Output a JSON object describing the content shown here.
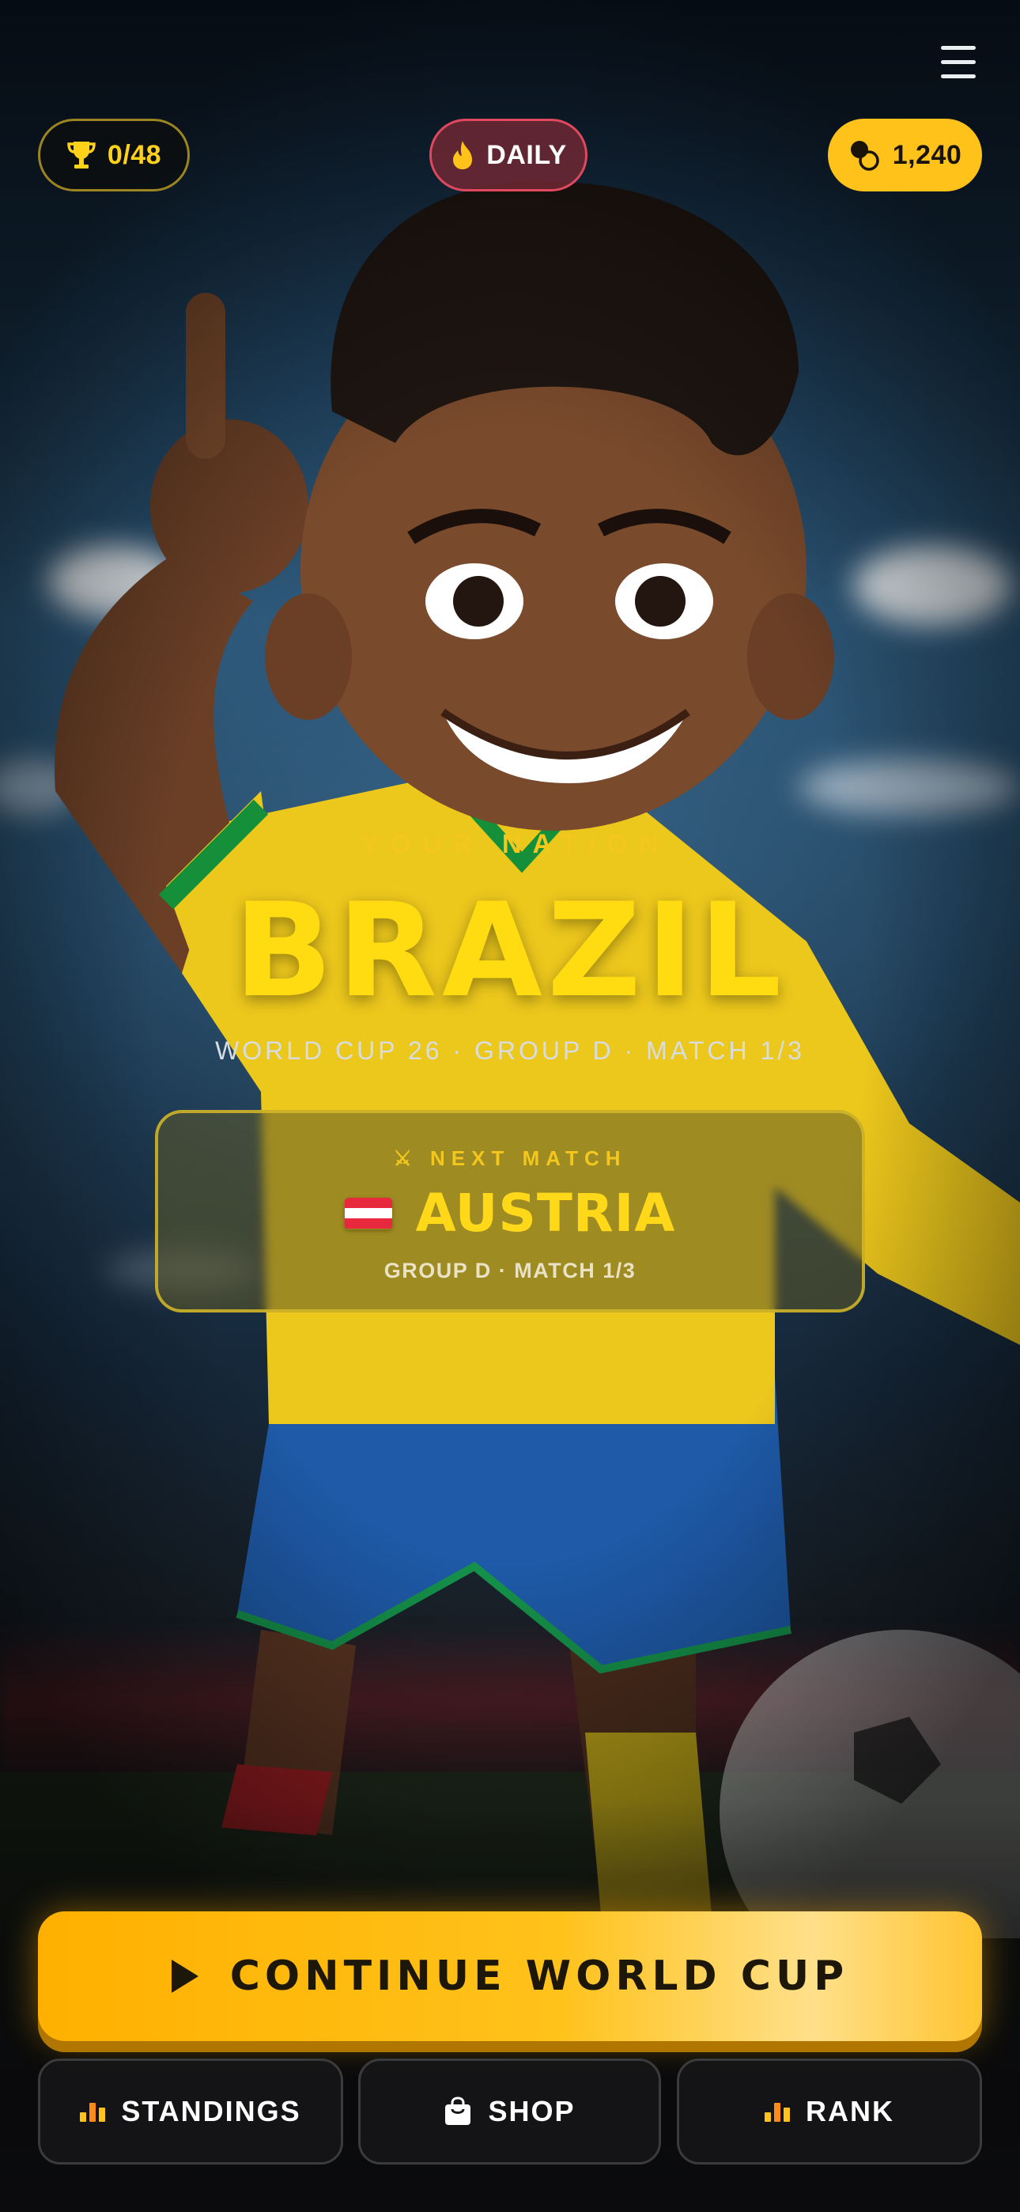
{
  "top_bar": {
    "trophy_count": "0/48",
    "daily_label": "DAILY",
    "coins": "1,240"
  },
  "hero": {
    "nation_label": "YOUR NATION",
    "nation_name": "BRAZIL",
    "subtitle": "WORLD CUP 26 · GROUP D · MATCH 1/3"
  },
  "next_match": {
    "label": "⚔ NEXT MATCH",
    "opponent": "AUSTRIA",
    "meta": "GROUP D · MATCH 1/3",
    "flag_colors": [
      "#e8283c",
      "#ffffff",
      "#e8283c"
    ]
  },
  "actions": {
    "continue_label": "CONTINUE WORLD CUP",
    "standings_label": "STANDINGS",
    "shop_label": "SHOP",
    "rank_label": "RANK"
  },
  "colors": {
    "accent_yellow": "#ffd21a",
    "cta_orange": "#ffb000",
    "daily_red": "#e0485f"
  },
  "icons": [
    "menu-icon",
    "trophy-icon",
    "flame-icon",
    "coins-icon",
    "play-icon",
    "bar-chart-icon",
    "bag-icon"
  ]
}
